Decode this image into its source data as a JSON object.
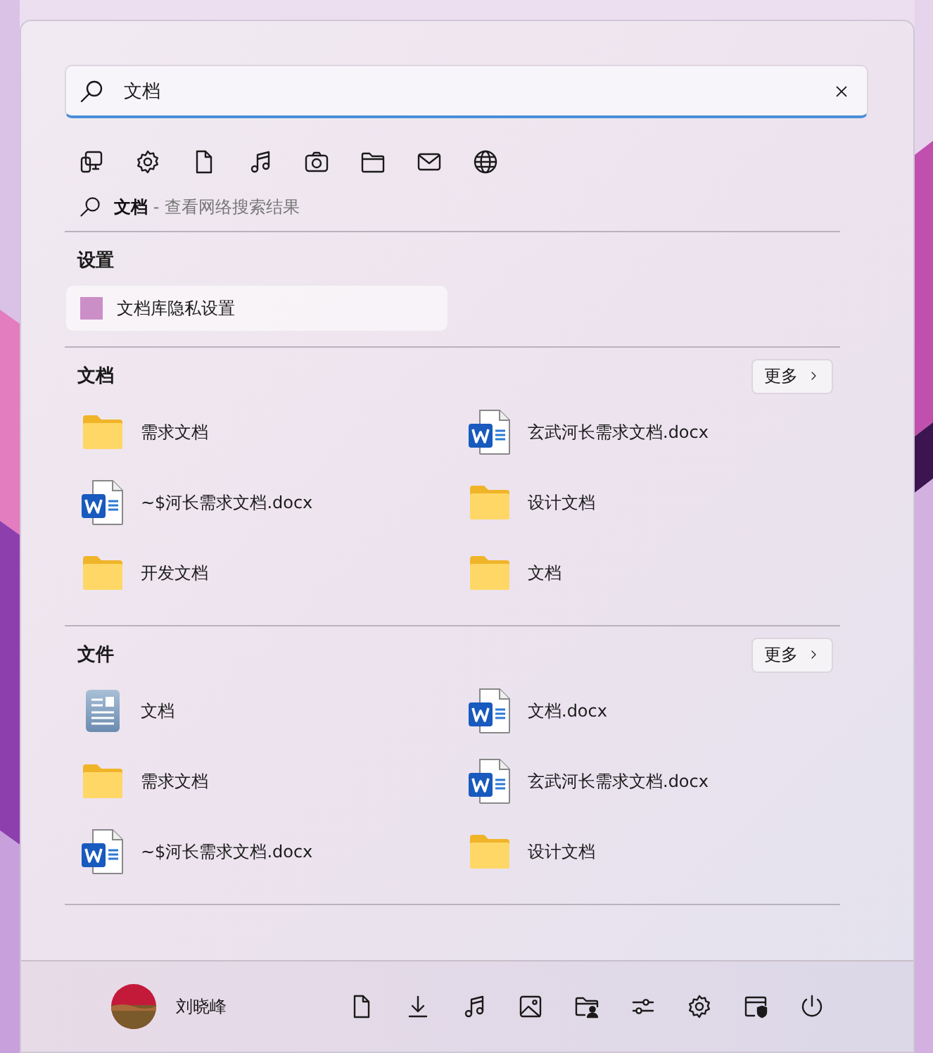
{
  "search": {
    "value": "文档"
  },
  "web_search": {
    "text": "**文档** - 查看网络搜索结果"
  },
  "sections": [
    {
      "kind": "settings",
      "title": "设置",
      "items": [
        {
          "label": "文档库隐私设置",
          "selected": true
        }
      ]
    },
    {
      "kind": "grid",
      "title": "文档",
      "more": "更多",
      "items": [
        {
          "kind": "folder",
          "label": "需求文档"
        },
        {
          "kind": "word",
          "label": "玄武河长需求文档.docx"
        },
        {
          "kind": "word",
          "label": "~$河长需求文档.docx"
        },
        {
          "kind": "folder",
          "label": "设计文档"
        },
        {
          "kind": "folder",
          "label": "开发文档"
        },
        {
          "kind": "folder",
          "label": "文档"
        }
      ]
    },
    {
      "kind": "grid",
      "title": "文件",
      "more": "更多",
      "items": [
        {
          "kind": "library",
          "label": "文档"
        },
        {
          "kind": "word",
          "label": "文档.docx"
        },
        {
          "kind": "folder",
          "label": "需求文档"
        },
        {
          "kind": "word",
          "label": "玄武河长需求文档.docx"
        },
        {
          "kind": "word",
          "label": "~$河长需求文档.docx"
        },
        {
          "kind": "folder",
          "label": "设计文档"
        }
      ]
    }
  ],
  "user": {
    "name": "刘晓峰"
  }
}
